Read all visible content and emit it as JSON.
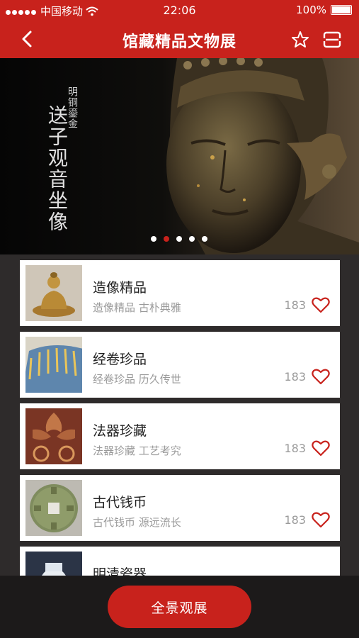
{
  "status_bar": {
    "carrier": "中国移动",
    "time": "22:06",
    "battery": "100%"
  },
  "nav": {
    "title": "馆藏精品文物展",
    "back_icon": "chevron-left-icon",
    "favorite_icon": "star-icon",
    "menu_icon": "menu-icon"
  },
  "banner": {
    "subtitle": "明铜鎏金",
    "title": "送子观音坐像",
    "page_count": 5,
    "active_index": 1
  },
  "collections": [
    {
      "name": "造像精品",
      "desc": "造像精品 古朴典雅",
      "likes": "183",
      "thumb": "buddha-statue"
    },
    {
      "name": "经卷珍品",
      "desc": "经卷珍品 历久传世",
      "likes": "183",
      "thumb": "scroll-fan"
    },
    {
      "name": "法器珍藏",
      "desc": "法器珍藏 工艺考究",
      "likes": "183",
      "thumb": "ritual-object"
    },
    {
      "name": "古代钱币",
      "desc": "古代钱币 源远流长",
      "likes": "183",
      "thumb": "ancient-coin"
    },
    {
      "name": "明清瓷器",
      "desc": "",
      "likes": "",
      "thumb": "porcelain-jar"
    }
  ],
  "footer": {
    "panorama_button": "全景观展"
  },
  "colors": {
    "brand_red": "#c8221c",
    "background": "#2e2b2b"
  }
}
